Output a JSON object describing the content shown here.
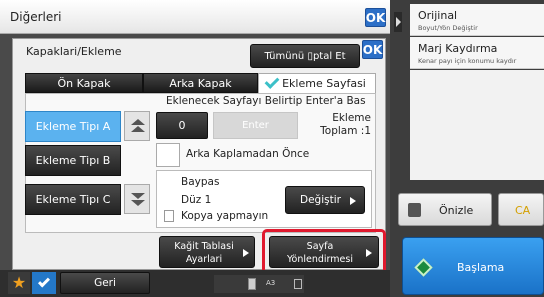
{
  "app": {
    "title": "Diğerleri",
    "ok_label": "OK"
  },
  "right_panel": {
    "items": [
      {
        "title": "Orijinal",
        "subtitle": "Boyut/Yön Değiştir"
      },
      {
        "title": "Marj Kaydırma",
        "subtitle": "Kenar payı için konumu kaydır"
      }
    ],
    "preview_label": "Önizle",
    "ca_label": "CA",
    "start_label": "Başlama"
  },
  "dialog": {
    "title": "Kapaklari/Ekleme",
    "ok_label": "OK",
    "cancel_all_label": "Tümünü ▯ptal Et",
    "tabs": [
      "Ön Kapak",
      "Arka Kapak",
      "Ekleme Sayfasi"
    ],
    "instruction": "Eklenecek Sayfayı Belirtip Enter'a Bas",
    "page_value": "0",
    "enter_label": "Enter",
    "total_label": "Ekleme\nToplam :1",
    "insert_types": [
      "Ekleme Tipı A",
      "Ekleme Tipı B",
      "Ekleme Tipı C"
    ],
    "option_label": "Arka Kaplamadan Önce",
    "bypass_label": "Baypas",
    "plain_label": "Düz 1",
    "no_copy_label": "Kopya yapmayın",
    "change_label": "Değiştir",
    "paper_tray_label": "Kağit Tablasi\nAyarlari",
    "page_orientation_label": "Sayfa\nYönlendirmesi"
  },
  "bottom": {
    "back_label": "Geri",
    "paper_size": "A3"
  },
  "colors": {
    "accent_blue": "#2c6fc7",
    "highlight_red": "#e0192e",
    "selected_blue": "#5bb2ef",
    "check_teal": "#3cc0c8"
  }
}
